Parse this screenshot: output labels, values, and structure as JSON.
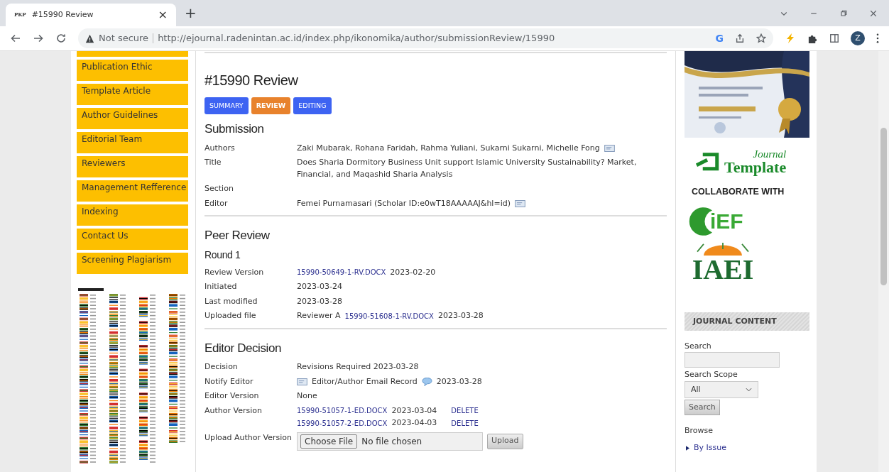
{
  "browser": {
    "tab": {
      "favicon": "PKP",
      "title": "#15990 Review",
      "close": "×"
    },
    "new_tab": "+",
    "security": "Not secure",
    "url": "http://ejournal.radenintan.ac.id/index.php/ikonomika/author/submissionReview/15990",
    "search_engine": "G",
    "avatar": "Z"
  },
  "left_menu": {
    "items": [
      {
        "label": "Publication Ethic"
      },
      {
        "label": "Template Article"
      },
      {
        "label": "Author Guidelines"
      },
      {
        "label": "Editorial Team"
      },
      {
        "label": "Reviewers"
      },
      {
        "label": "Management Refference"
      },
      {
        "label": "Indexing"
      },
      {
        "label": "Contact Us"
      },
      {
        "label": "Screening Plagiarism"
      }
    ]
  },
  "main": {
    "title": "#15990 Review",
    "tabs": [
      {
        "label": "SUMMARY",
        "selected": false
      },
      {
        "label": "REVIEW",
        "selected": true
      },
      {
        "label": "EDITING",
        "selected": false
      }
    ],
    "sections": [
      {
        "heading": "Submission",
        "rows": [
          {
            "label": "Authors",
            "lines": [
              [
                {
                  "kind": "text",
                  "text": "Zaki Mubarak, Rohana Faridah, Rahma Yuliani, Sukarni Sukarni, Michelle Fong"
                },
                {
                  "kind": "mail"
                }
              ]
            ]
          },
          {
            "label": "Title",
            "lines": [
              [
                {
                  "kind": "text",
                  "text": "Does Sharia Dormitory Business Unit support Islamic University Sustainability? Market, Financial, and Maqashid Sharia Analysis"
                }
              ]
            ]
          },
          {
            "label": "Section",
            "lines": []
          },
          {
            "label": "Editor",
            "lines": [
              [
                {
                  "kind": "text",
                  "text": "Femei Purnamasari (Scholar ID:e0wT18AAAAAJ&hl=id)"
                },
                {
                  "kind": "mail"
                }
              ]
            ]
          }
        ]
      },
      {
        "heading": "Peer Review",
        "subheading": "Round 1",
        "rows": [
          {
            "label": "Review Version",
            "lines": [
              [
                {
                  "kind": "link",
                  "text": "15990-50649-1-RV.DOCX"
                },
                {
                  "kind": "text",
                  "text": "2023-02-20"
                }
              ]
            ]
          },
          {
            "label": "Initiated",
            "lines": [
              [
                {
                  "kind": "text",
                  "text": "2023-03-24"
                }
              ]
            ]
          },
          {
            "label": "Last modified",
            "lines": [
              [
                {
                  "kind": "text",
                  "text": "2023-03-28"
                }
              ]
            ]
          },
          {
            "label": "Uploaded file",
            "lines": [
              [
                {
                  "kind": "text",
                  "text": "Reviewer A"
                },
                {
                  "kind": "link",
                  "text": "15990-51608-1-RV.DOCX"
                },
                {
                  "kind": "text",
                  "text": "2023-03-28"
                }
              ]
            ]
          }
        ]
      },
      {
        "heading": "Editor Decision",
        "rows": [
          {
            "label": "Decision",
            "lines": [
              [
                {
                  "kind": "text",
                  "text": "Revisions Required 2023-03-28"
                }
              ]
            ]
          },
          {
            "label": "Notify Editor",
            "lines": [
              [
                {
                  "kind": "mail"
                },
                {
                  "kind": "text",
                  "text": "Editor/Author Email Record"
                },
                {
                  "kind": "comment"
                },
                {
                  "kind": "text",
                  "text": "2023-03-28"
                }
              ]
            ]
          },
          {
            "label": "Editor Version",
            "lines": [
              [
                {
                  "kind": "text",
                  "text": "None"
                }
              ]
            ]
          },
          {
            "label": "Author Version",
            "lines": [
              [
                {
                  "kind": "link",
                  "text": "15990-51057-1-ED.DOCX"
                },
                {
                  "kind": "text",
                  "text": "2023-03-04"
                },
                {
                  "kind": "action",
                  "text": "DELETE"
                }
              ],
              [
                {
                  "kind": "link",
                  "text": "15990-51057-2-ED.DOCX"
                },
                {
                  "kind": "text",
                  "text": "2023-04-03"
                },
                {
                  "kind": "action",
                  "text": "DELETE"
                }
              ]
            ]
          },
          {
            "label": "Upload Author Version",
            "lines": [
              [
                {
                  "kind": "file",
                  "button": "Choose File",
                  "text": "No file chosen"
                },
                {
                  "kind": "button",
                  "text": "Upload"
                }
              ]
            ]
          }
        ]
      }
    ]
  },
  "right_sidebar": {
    "journal_logo": {
      "script": "Journal",
      "word": "Template"
    },
    "collaborate": "COLLABORATE WITH",
    "ief_logo": "iEF",
    "iaei_logo": "IAEI",
    "block_title": "JOURNAL CONTENT",
    "search_label": "Search",
    "scope_label": "Search Scope",
    "scope_value": "All",
    "search_button": "Search",
    "browse_label": "Browse",
    "browse_links": [
      "By Issue"
    ]
  }
}
